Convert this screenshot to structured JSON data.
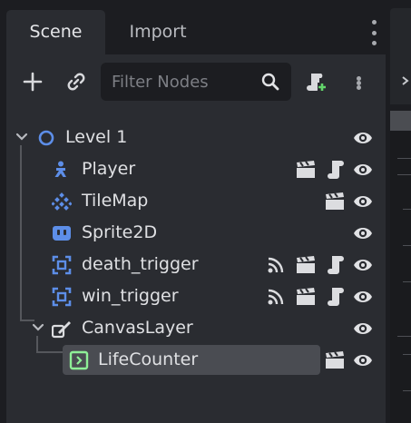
{
  "tabs": {
    "scene": "Scene",
    "import": "Import"
  },
  "toolbar": {
    "filter_placeholder": "Filter Nodes",
    "icons": [
      "add-icon",
      "link-icon",
      "search-icon",
      "add-script-icon",
      "more-vertical-icon"
    ]
  },
  "tree": {
    "nodes": [
      {
        "name": "Level 1",
        "type_icon": "node2d-circle-icon",
        "expanded": true
      },
      {
        "name": "Player",
        "type_icon": "character-body-icon"
      },
      {
        "name": "TileMap",
        "type_icon": "tilemap-icon"
      },
      {
        "name": "Sprite2D",
        "type_icon": "sprite2d-icon"
      },
      {
        "name": "death_trigger",
        "type_icon": "area2d-icon"
      },
      {
        "name": "win_trigger",
        "type_icon": "area2d-icon"
      },
      {
        "name": "CanvasLayer",
        "type_icon": "canvas-layer-icon",
        "expanded": true
      },
      {
        "name": "LifeCounter",
        "type_icon": "control-icon",
        "selected": true
      }
    ]
  },
  "colors": {
    "accent": "#5d8ee8",
    "control_green": "#8eef97",
    "background": "#1c1d21",
    "panel": "#2a2c31",
    "selection": "#4a4c52"
  }
}
